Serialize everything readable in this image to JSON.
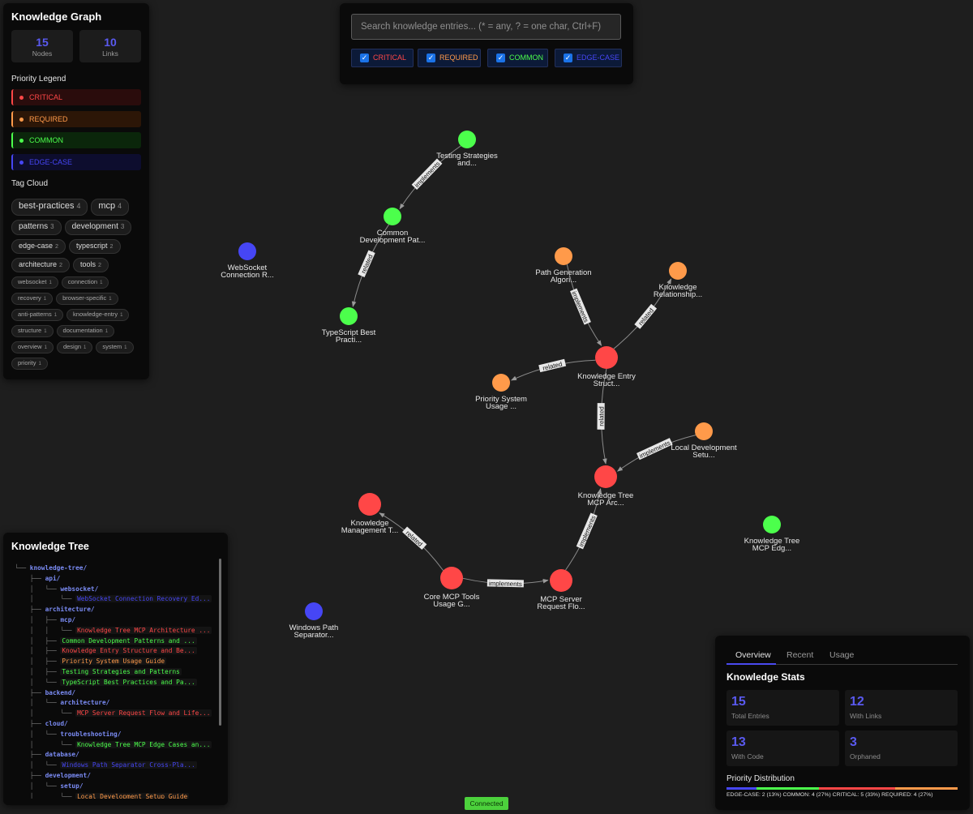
{
  "colors": {
    "critical": "#ff4747",
    "required": "#ff9a4a",
    "common": "#4cff4c",
    "edge_case": "#4646f5"
  },
  "sidebar": {
    "title": "Knowledge Graph",
    "stats": [
      {
        "value": "15",
        "label": "Nodes"
      },
      {
        "value": "10",
        "label": "Links"
      }
    ],
    "legend_title": "Priority Legend",
    "legend": [
      {
        "label": "CRITICAL",
        "key": "critical"
      },
      {
        "label": "REQUIRED",
        "key": "required"
      },
      {
        "label": "COMMON",
        "key": "common"
      },
      {
        "label": "EDGE-CASE",
        "key": "edge_case"
      }
    ],
    "tag_cloud_title": "Tag Cloud",
    "tags": [
      {
        "name": "best-practices",
        "count": "4"
      },
      {
        "name": "mcp",
        "count": "4"
      },
      {
        "name": "patterns",
        "count": "3"
      },
      {
        "name": "development",
        "count": "3"
      },
      {
        "name": "edge-case",
        "count": "2"
      },
      {
        "name": "typescript",
        "count": "2"
      },
      {
        "name": "architecture",
        "count": "2"
      },
      {
        "name": "tools",
        "count": "2"
      },
      {
        "name": "websocket",
        "count": "1"
      },
      {
        "name": "connection",
        "count": "1"
      },
      {
        "name": "recovery",
        "count": "1"
      },
      {
        "name": "browser-specific",
        "count": "1"
      },
      {
        "name": "anti-patterns",
        "count": "1"
      },
      {
        "name": "knowledge-entry",
        "count": "1"
      },
      {
        "name": "structure",
        "count": "1"
      },
      {
        "name": "documentation",
        "count": "1"
      },
      {
        "name": "overview",
        "count": "1"
      },
      {
        "name": "design",
        "count": "1"
      },
      {
        "name": "system",
        "count": "1"
      },
      {
        "name": "priority",
        "count": "1"
      }
    ]
  },
  "search": {
    "placeholder": "Search knowledge entries... (* = any, ? = one char, Ctrl+F)",
    "filters": [
      {
        "label": "CRITICAL",
        "checked": true,
        "key": "critical"
      },
      {
        "label": "REQUIRED",
        "checked": true,
        "key": "required"
      },
      {
        "label": "COMMON",
        "checked": true,
        "key": "common"
      },
      {
        "label": "EDGE-CASE",
        "checked": true,
        "key": "edge_case"
      }
    ]
  },
  "graph": {
    "nodes": [
      {
        "id": "testing",
        "lines": [
          "Testing Strategies",
          "and..."
        ],
        "priority": "common"
      },
      {
        "id": "common-dev",
        "lines": [
          "Common",
          "Development Pat..."
        ],
        "priority": "common"
      },
      {
        "id": "ts-best",
        "lines": [
          "TypeScript Best",
          "Practi..."
        ],
        "priority": "common"
      },
      {
        "id": "websocket",
        "lines": [
          "WebSocket",
          "Connection R..."
        ],
        "priority": "edge_case"
      },
      {
        "id": "path-gen",
        "lines": [
          "Path Generation",
          "Algori..."
        ],
        "priority": "required"
      },
      {
        "id": "knowledge-rel",
        "lines": [
          "Knowledge",
          "Relationship..."
        ],
        "priority": "required"
      },
      {
        "id": "entry-struct",
        "lines": [
          "Knowledge Entry",
          "Struct..."
        ],
        "priority": "critical"
      },
      {
        "id": "priority-sys",
        "lines": [
          "Priority System",
          "Usage ..."
        ],
        "priority": "required"
      },
      {
        "id": "local-dev",
        "lines": [
          "Local Development",
          "Setu..."
        ],
        "priority": "required"
      },
      {
        "id": "tree-arch",
        "lines": [
          "Knowledge Tree",
          "MCP Arc..."
        ],
        "priority": "critical"
      },
      {
        "id": "km-tools",
        "lines": [
          "Knowledge",
          "Management T..."
        ],
        "priority": "critical"
      },
      {
        "id": "core-tools",
        "lines": [
          "Core MCP Tools",
          "Usage G..."
        ],
        "priority": "critical"
      },
      {
        "id": "server-flow",
        "lines": [
          "MCP Server",
          "Request Flo..."
        ],
        "priority": "critical"
      },
      {
        "id": "edge-cases",
        "lines": [
          "Knowledge Tree",
          "MCP Edg..."
        ],
        "priority": "common"
      },
      {
        "id": "win-path",
        "lines": [
          "Windows Path",
          "Separator..."
        ],
        "priority": "edge_case"
      }
    ],
    "links": [
      {
        "source": "testing",
        "target": "common-dev",
        "label": "implements"
      },
      {
        "source": "common-dev",
        "target": "ts-best",
        "label": "related"
      },
      {
        "source": "path-gen",
        "target": "entry-struct",
        "label": "implements"
      },
      {
        "source": "entry-struct",
        "target": "knowledge-rel",
        "label": "related"
      },
      {
        "source": "entry-struct",
        "target": "priority-sys",
        "label": "related"
      },
      {
        "source": "entry-struct",
        "target": "tree-arch",
        "label": "related"
      },
      {
        "source": "local-dev",
        "target": "tree-arch",
        "label": "implements"
      },
      {
        "source": "server-flow",
        "target": "tree-arch",
        "label": "implements"
      },
      {
        "source": "core-tools",
        "target": "server-flow",
        "label": "implements"
      },
      {
        "source": "core-tools",
        "target": "km-tools",
        "label": "related"
      }
    ]
  },
  "tree": {
    "title": "Knowledge Tree",
    "rows": [
      {
        "prefix": "└── ",
        "name": "knowledge-tree/",
        "type": "dir"
      },
      {
        "prefix": "    ├── ",
        "name": "api/",
        "type": "dir"
      },
      {
        "prefix": "    │   └── ",
        "name": "websocket/",
        "type": "dir"
      },
      {
        "prefix": "    │       └── ",
        "name": "WebSocket Connection Recovery Ed...",
        "type": "file",
        "priority": "edge_case"
      },
      {
        "prefix": "    ├── ",
        "name": "architecture/",
        "type": "dir"
      },
      {
        "prefix": "    │   ├── ",
        "name": "mcp/",
        "type": "dir"
      },
      {
        "prefix": "    │   │   └── ",
        "name": "Knowledge Tree MCP Architecture ...",
        "type": "file",
        "priority": "critical"
      },
      {
        "prefix": "    │   ├── ",
        "name": "Common Development Patterns and ...",
        "type": "file",
        "priority": "common"
      },
      {
        "prefix": "    │   ├── ",
        "name": "Knowledge Entry Structure and Be...",
        "type": "file",
        "priority": "critical"
      },
      {
        "prefix": "    │   ├── ",
        "name": "Priority System Usage Guide",
        "type": "file",
        "priority": "required"
      },
      {
        "prefix": "    │   ├── ",
        "name": "Testing Strategies and Patterns",
        "type": "file",
        "priority": "common"
      },
      {
        "prefix": "    │   └── ",
        "name": "TypeScript Best Practices and Pa...",
        "type": "file",
        "priority": "common"
      },
      {
        "prefix": "    ├── ",
        "name": "backend/",
        "type": "dir"
      },
      {
        "prefix": "    │   └── ",
        "name": "architecture/",
        "type": "dir"
      },
      {
        "prefix": "    │       └── ",
        "name": "MCP Server Request Flow and Life...",
        "type": "file",
        "priority": "critical"
      },
      {
        "prefix": "    ├── ",
        "name": "cloud/",
        "type": "dir"
      },
      {
        "prefix": "    │   └── ",
        "name": "troubleshooting/",
        "type": "dir"
      },
      {
        "prefix": "    │       └── ",
        "name": "Knowledge Tree MCP Edge Cases an...",
        "type": "file",
        "priority": "common"
      },
      {
        "prefix": "    ├── ",
        "name": "database/",
        "type": "dir"
      },
      {
        "prefix": "    │   └── ",
        "name": "Windows Path Separator Cross-Pla...",
        "type": "file",
        "priority": "edge_case"
      },
      {
        "prefix": "    ├── ",
        "name": "development/",
        "type": "dir"
      },
      {
        "prefix": "    │   └── ",
        "name": "setup/",
        "type": "dir"
      },
      {
        "prefix": "    │       └── ",
        "name": "Local Development Setup Guide",
        "type": "file",
        "priority": "required"
      }
    ]
  },
  "stats_panel": {
    "tabs": [
      "Overview",
      "Recent",
      "Usage"
    ],
    "active_tab": "Overview",
    "title": "Knowledge Stats",
    "boxes": [
      {
        "value": "15",
        "label": "Total Entries"
      },
      {
        "value": "12",
        "label": "With Links"
      },
      {
        "value": "13",
        "label": "With Code"
      },
      {
        "value": "3",
        "label": "Orphaned"
      }
    ],
    "distribution_title": "Priority Distribution",
    "distribution": [
      {
        "key": "edge_case",
        "fraction": 0.13
      },
      {
        "key": "common",
        "fraction": 0.27
      },
      {
        "key": "critical",
        "fraction": 0.33
      },
      {
        "key": "required",
        "fraction": 0.27
      }
    ],
    "distribution_text": "EDGE-CASE: 2 (13%) COMMON: 4 (27%) CRITICAL: 5 (33%) REQUIRED: 4 (27%)"
  },
  "status": {
    "connection": "Connected"
  }
}
